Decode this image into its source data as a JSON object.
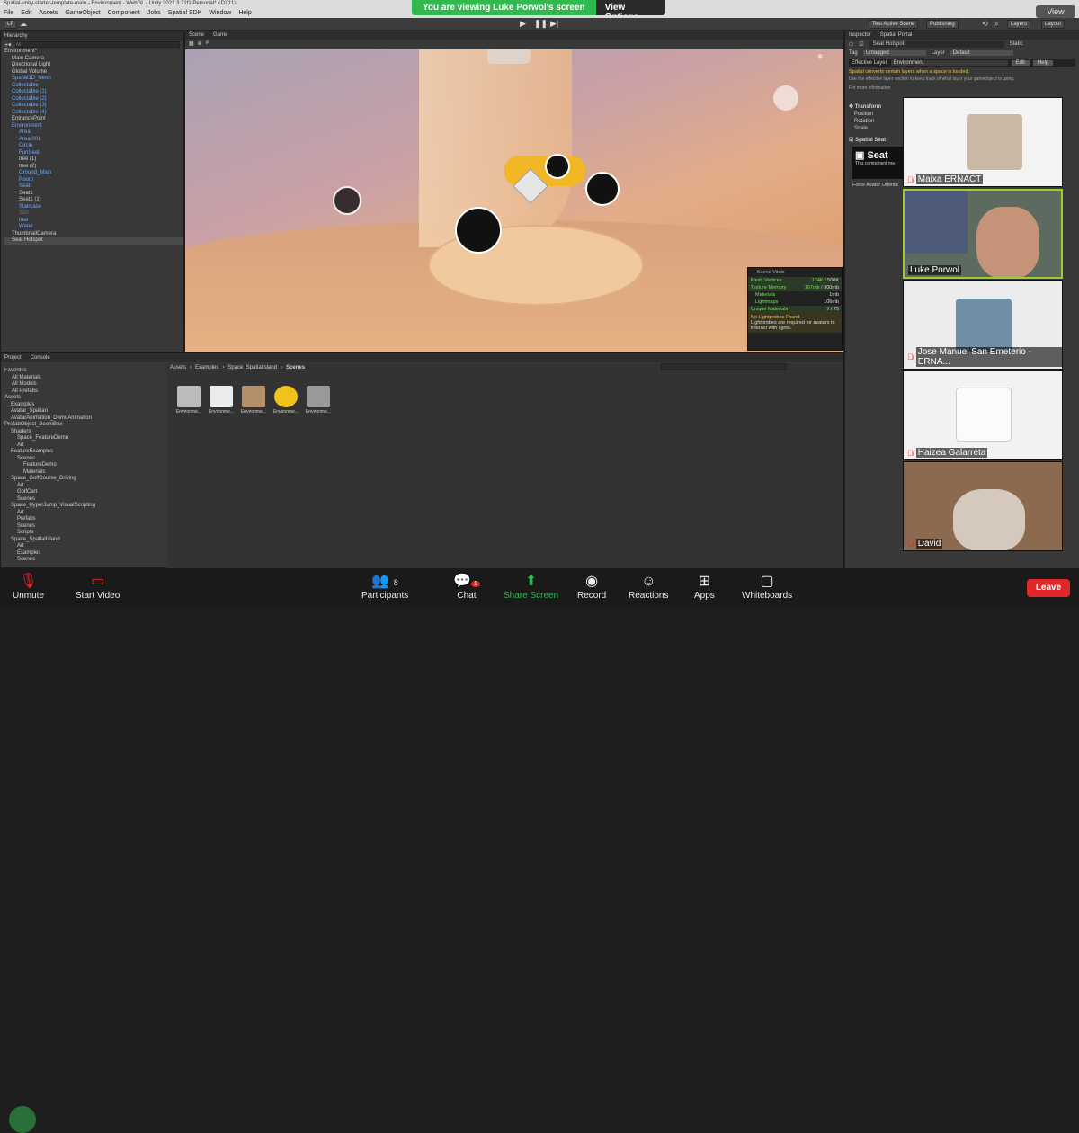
{
  "window": {
    "title": "Spatial-unity-starter-template-main - Environment - WebGL - Unity 2021.3.21f1 Personal* <DX11>",
    "menus": [
      "File",
      "Edit",
      "Assets",
      "GameObject",
      "Component",
      "Jobs",
      "Spatial SDK",
      "Window",
      "Help"
    ]
  },
  "share_banner": {
    "message": "You are viewing Luke Porwol's screen",
    "options": "View Options"
  },
  "view_button": "View",
  "toolbar": {
    "account": "LP",
    "right": [
      "Test Active Scene",
      "Publishing",
      "Layers",
      "Layout"
    ]
  },
  "hierarchy": {
    "tab": "Hierarchy",
    "search_placeholder": "All",
    "items": [
      {
        "label": "Environment*",
        "style": "root"
      },
      {
        "label": "Main Camera",
        "style": "normal"
      },
      {
        "label": "Directional Light",
        "style": "normal"
      },
      {
        "label": "Global Volume",
        "style": "normal"
      },
      {
        "label": "Spatial3D_Neon",
        "style": "blue"
      },
      {
        "label": "Collectable",
        "style": "blue"
      },
      {
        "label": "Collectable (1)",
        "style": "blue"
      },
      {
        "label": "Collectable (2)",
        "style": "blue"
      },
      {
        "label": "Collectable (3)",
        "style": "blue"
      },
      {
        "label": "Collectable (4)",
        "style": "blue"
      },
      {
        "label": "EntrancePoint",
        "style": "normal"
      },
      {
        "label": "Environment",
        "style": "blue"
      },
      {
        "label": "Area",
        "style": "blue"
      },
      {
        "label": "Area.001",
        "style": "blue"
      },
      {
        "label": "Circle",
        "style": "blue"
      },
      {
        "label": "FunSeat",
        "style": "blue"
      },
      {
        "label": "tree (1)",
        "style": "normal"
      },
      {
        "label": "tree (2)",
        "style": "normal"
      },
      {
        "label": "Ground_Main",
        "style": "blue"
      },
      {
        "label": "Room",
        "style": "blue"
      },
      {
        "label": "Seat",
        "style": "blue"
      },
      {
        "label": "Seat1",
        "style": "normal"
      },
      {
        "label": "Seat1 (1)",
        "style": "normal"
      },
      {
        "label": "Staircase",
        "style": "blue"
      },
      {
        "label": "Sun",
        "style": "dim"
      },
      {
        "label": "tree",
        "style": "blue"
      },
      {
        "label": "Water",
        "style": "blue"
      },
      {
        "label": "ThumbnailCamera",
        "style": "normal"
      },
      {
        "label": "Seat Hotspot",
        "style": "sel"
      }
    ]
  },
  "scene_tabs": [
    "Scene",
    "Game"
  ],
  "scene_vitals": {
    "title": "Scene Vitals",
    "mesh_vertices": {
      "label": "Mesh Vertices",
      "value": "124K",
      "limit": "/ 500K"
    },
    "texture_memory": {
      "label": "Texture Memory",
      "value": "107mb",
      "limit": "/ 300mb"
    },
    "materials": {
      "label": "Materials",
      "value": "1mb"
    },
    "lightmaps": {
      "label": "Lightmaps",
      "value": "106mb"
    },
    "unique_materials": {
      "label": "Unique Materials",
      "value": "9",
      "limit": "/ 75"
    },
    "warning_title": "No Lightprobes Found",
    "warning_text": "Lightprobes are required for avatars to interact with lights."
  },
  "inspector": {
    "tabs": [
      "Inspector",
      "Spatial Portal"
    ],
    "object_name": "Seat Hotspot",
    "static_label": "Static",
    "tag_label": "Tag",
    "tag_value": "Untagged",
    "layer_label": "Layer",
    "layer_value": "Default",
    "effective_layer_label": "Effective Layer",
    "effective_layer_value": "Environment",
    "edit_button": "Edit",
    "help_button": "Help",
    "info_title": "Spatial converts certain layers when a space is loaded.",
    "info_text": "Use the effective layer section to keep track of what layer your gameobject is using.",
    "more_info": "For more information",
    "transform": "Transform",
    "position": "Position",
    "rotation": "Rotation",
    "scale": "Scale",
    "component": "Spatial Seat",
    "seat_title": "Seat",
    "seat_desc": "This component ma",
    "force_avatar": "Force Avatar Orienta"
  },
  "project": {
    "tabs": [
      "Project",
      "Console"
    ],
    "favorites": [
      "Favorites",
      "All Materials",
      "All Models",
      "All Prefabs"
    ],
    "assets_tree": [
      "Assets",
      "Examples",
      "Avatar_Spatian",
      "AvatarAnimation_DemoAnimation",
      "PrefabObject_BoomBox",
      "Shaders",
      "Space_FeatureDemo",
      "Art",
      "FeatureExamples",
      "Scenes",
      "FeatureDemo",
      "Materials",
      "Space_GolfCourse_Driving",
      "Art",
      "GolfCart",
      "Scenes",
      "Space_HyperJump_VisualScripting",
      "Art",
      "Prefabs",
      "Scenes",
      "Scripts",
      "Space_SpatialIsland",
      "Art",
      "Examples",
      "Scenes"
    ],
    "breadcrumb": [
      "Assets",
      "Examples",
      "Space_SpatialIsland",
      "Scenes"
    ],
    "files": [
      "Environme...",
      "Environme...",
      "Environme...",
      "Environme...",
      "Environme..."
    ]
  },
  "participants": [
    {
      "name": "Maixa ERNACT"
    },
    {
      "name": "Luke Porwol"
    },
    {
      "name": "Jose Manuel San Emeterio - ERNA..."
    },
    {
      "name": "Haizea Galarreta"
    },
    {
      "name": "David"
    }
  ],
  "zoom": {
    "unmute": "Unmute",
    "start_video": "Start Video",
    "participants": "Participants",
    "participants_count": "8",
    "chat": "Chat",
    "chat_badge": "1",
    "share_screen": "Share Screen",
    "record": "Record",
    "reactions": "Reactions",
    "apps": "Apps",
    "whiteboards": "Whiteboards",
    "leave": "Leave"
  },
  "colors": {
    "accent_green": "#2fb94f",
    "leave_red": "#e02828",
    "unity_bg": "#383838"
  }
}
